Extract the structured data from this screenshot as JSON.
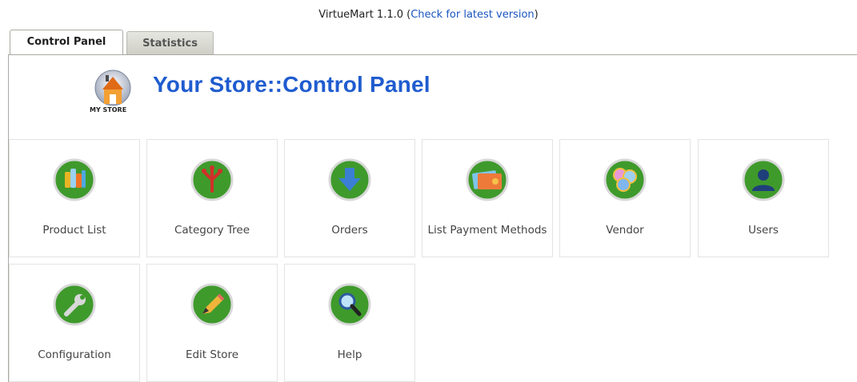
{
  "header": {
    "version_prefix": "VirtueMart 1.1.0 (",
    "version_link": "Check for latest version",
    "version_suffix": ")"
  },
  "tabs": [
    {
      "label": "Control Panel",
      "active": true
    },
    {
      "label": "Statistics",
      "active": false
    }
  ],
  "store": {
    "logo_text": "MY STORE",
    "title": "Your Store::Control Panel"
  },
  "tiles": [
    {
      "label": "Product List",
      "icon": "product-list-icon"
    },
    {
      "label": "Category Tree",
      "icon": "category-tree-icon"
    },
    {
      "label": "Orders",
      "icon": "orders-icon"
    },
    {
      "label": "List Payment Methods",
      "icon": "payment-methods-icon"
    },
    {
      "label": "Vendor",
      "icon": "vendor-icon"
    },
    {
      "label": "Users",
      "icon": "users-icon"
    },
    {
      "label": "Configuration",
      "icon": "configuration-icon"
    },
    {
      "label": "Edit Store",
      "icon": "edit-store-icon"
    },
    {
      "label": "Help",
      "icon": "help-icon"
    }
  ],
  "colors": {
    "title": "#1f5ccf",
    "link": "#1a55c0",
    "icon_green": "#3f9a2c"
  }
}
